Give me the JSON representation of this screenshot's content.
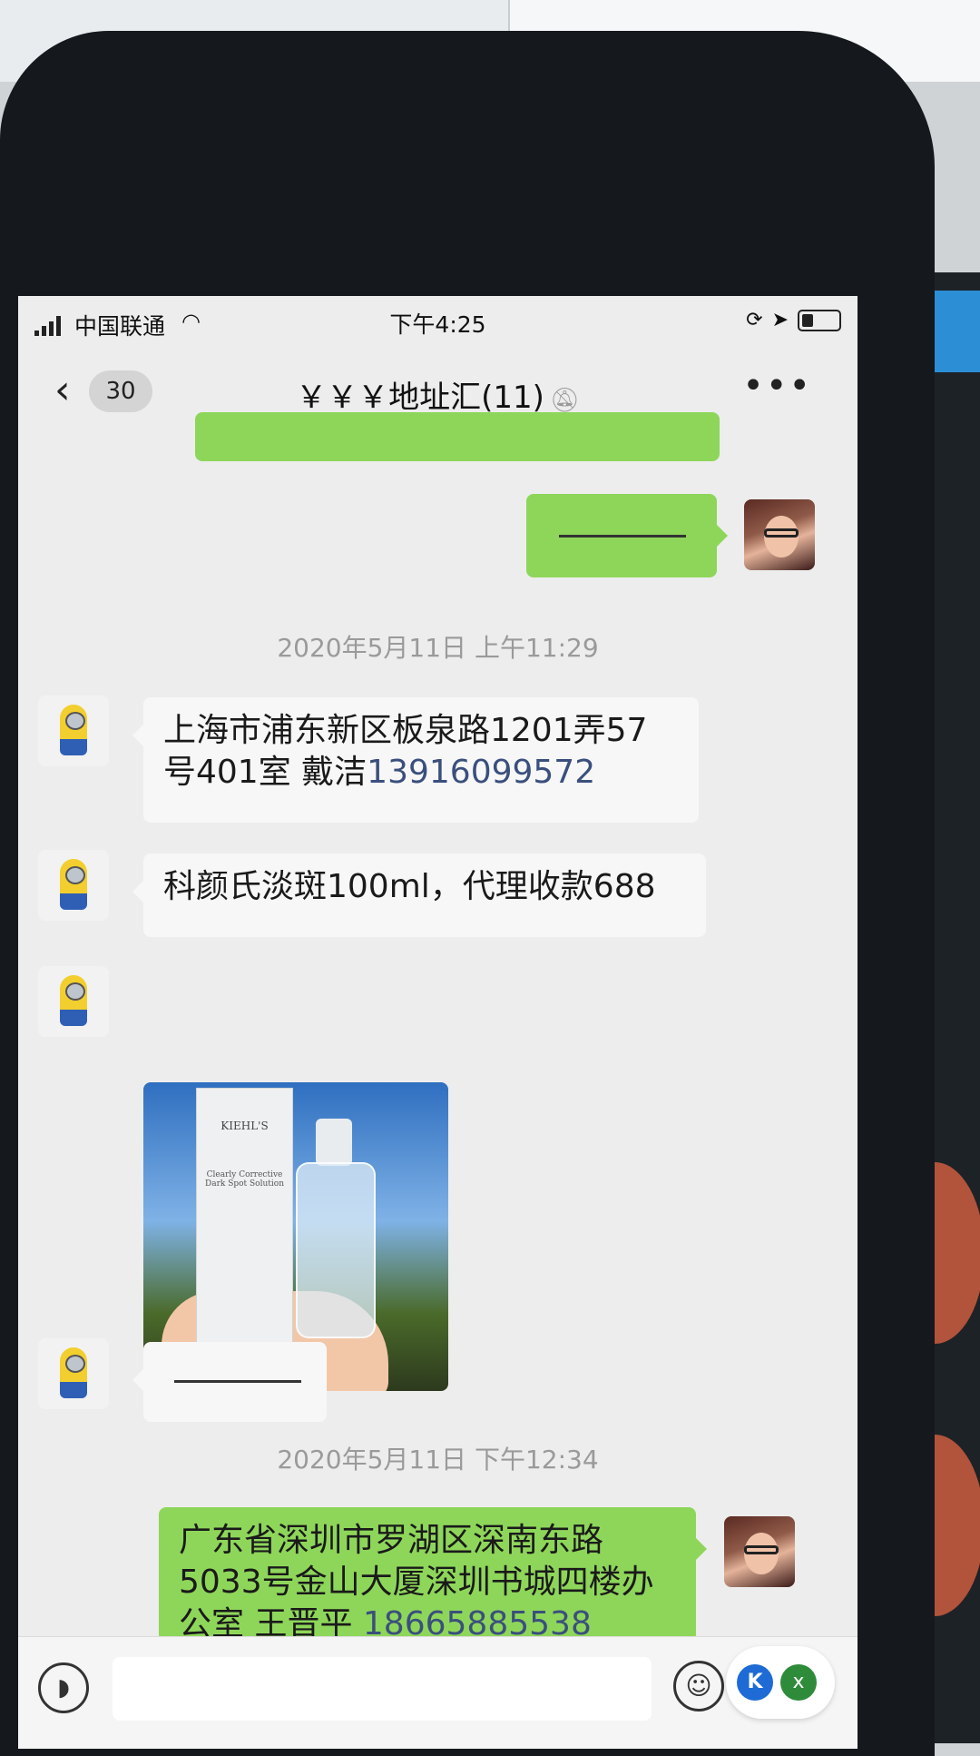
{
  "status_bar": {
    "carrier": "中国联通",
    "time": "下午4:25"
  },
  "navbar": {
    "unread_count": "30",
    "title": "￥￥￥地址汇(11)"
  },
  "messages": {
    "m1": {
      "text": "———"
    },
    "timestamp1": "2020年5月11日 上午11:29",
    "m2": {
      "text": "上海市浦东新区板泉路1201弄57号401室 戴洁",
      "phone": "13916099572"
    },
    "m3": {
      "text": "科颜氏淡斑100ml，代理收款688"
    },
    "m4": {
      "image_brand": "KIEHL'S",
      "image_product": "Clearly Corrective Dark Spot Solution"
    },
    "m5": {
      "text": "———"
    },
    "timestamp2": "2020年5月11日 下午12:34",
    "m6": {
      "text": "广东省深圳市罗湖区深南东路5033号金山大厦深圳书城四楼办公室 王晋平",
      "phone": "18665885538"
    }
  },
  "icons": {
    "back": "chevron-left-icon",
    "mute": "bell-off-icon",
    "more": "more-icon",
    "voice": "voice-icon",
    "emoji": "emoji-icon"
  },
  "colors": {
    "green_bubble": "#8ed65a",
    "white_bubble": "#f7f7f7",
    "chat_bg": "#ededed"
  }
}
